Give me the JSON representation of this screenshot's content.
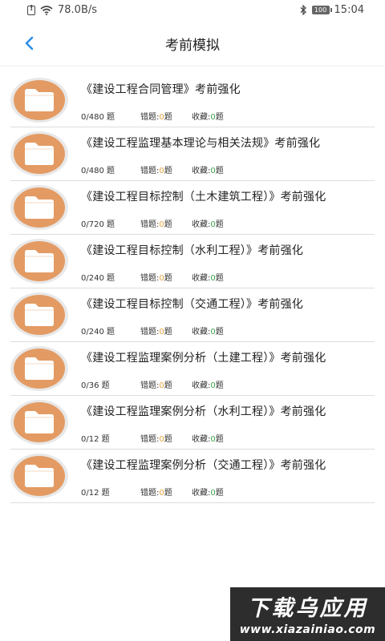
{
  "status_bar": {
    "net_speed": "78.0B/s",
    "battery": "100",
    "time": "15:04"
  },
  "header": {
    "title": "考前模拟"
  },
  "list": [
    {
      "title": "《建设工程合同管理》考前强化",
      "count": "0/480 题",
      "wrong_label": "错题:",
      "wrong_value": "0",
      "wrong_unit": "题",
      "fav_label": "收藏:",
      "fav_value": "0",
      "fav_unit": "题"
    },
    {
      "title": "《建设工程监理基本理论与相关法规》考前强化",
      "count": "0/480 题",
      "wrong_label": "错题:",
      "wrong_value": "0",
      "wrong_unit": "题",
      "fav_label": "收藏:",
      "fav_value": "0",
      "fav_unit": "题"
    },
    {
      "title": "《建设工程目标控制（土木建筑工程）》考前强化",
      "count": "0/720 题",
      "wrong_label": "错题:",
      "wrong_value": "0",
      "wrong_unit": "题",
      "fav_label": "收藏:",
      "fav_value": "0",
      "fav_unit": "题"
    },
    {
      "title": "《建设工程目标控制（水利工程）》考前强化",
      "count": "0/240 题",
      "wrong_label": "错题:",
      "wrong_value": "0",
      "wrong_unit": "题",
      "fav_label": "收藏:",
      "fav_value": "0",
      "fav_unit": "题"
    },
    {
      "title": "《建设工程目标控制（交通工程）》考前强化",
      "count": "0/240 题",
      "wrong_label": "错题:",
      "wrong_value": "0",
      "wrong_unit": "题",
      "fav_label": "收藏:",
      "fav_value": "0",
      "fav_unit": "题"
    },
    {
      "title": "《建设工程监理案例分析（土建工程）》考前强化",
      "count": "0/36 题",
      "wrong_label": "错题:",
      "wrong_value": "0",
      "wrong_unit": "题",
      "fav_label": "收藏:",
      "fav_value": "0",
      "fav_unit": "题"
    },
    {
      "title": "《建设工程监理案例分析（水利工程）》考前强化",
      "count": "0/12 题",
      "wrong_label": "错题:",
      "wrong_value": "0",
      "wrong_unit": "题",
      "fav_label": "收藏:",
      "fav_value": "0",
      "fav_unit": "题"
    },
    {
      "title": "《建设工程监理案例分析（交通工程）》考前强化",
      "count": "0/12 题",
      "wrong_label": "错题:",
      "wrong_value": "0",
      "wrong_unit": "题",
      "fav_label": "收藏:",
      "fav_value": "0",
      "fav_unit": "题"
    }
  ],
  "watermark": {
    "line1": "下载乌应用",
    "line2": "www.xiazainiao.com"
  },
  "colors": {
    "accent": "#2e8ee8",
    "folder_bg": "#e39b63",
    "wrong_num": "#e8a33c",
    "fav_num": "#3aa34a"
  },
  "icons": {
    "back": "chevron-left-icon",
    "folder": "folder-icon",
    "bluetooth": "bluetooth-icon",
    "wifi": "wifi-icon",
    "sim": "sim-alert-icon"
  }
}
